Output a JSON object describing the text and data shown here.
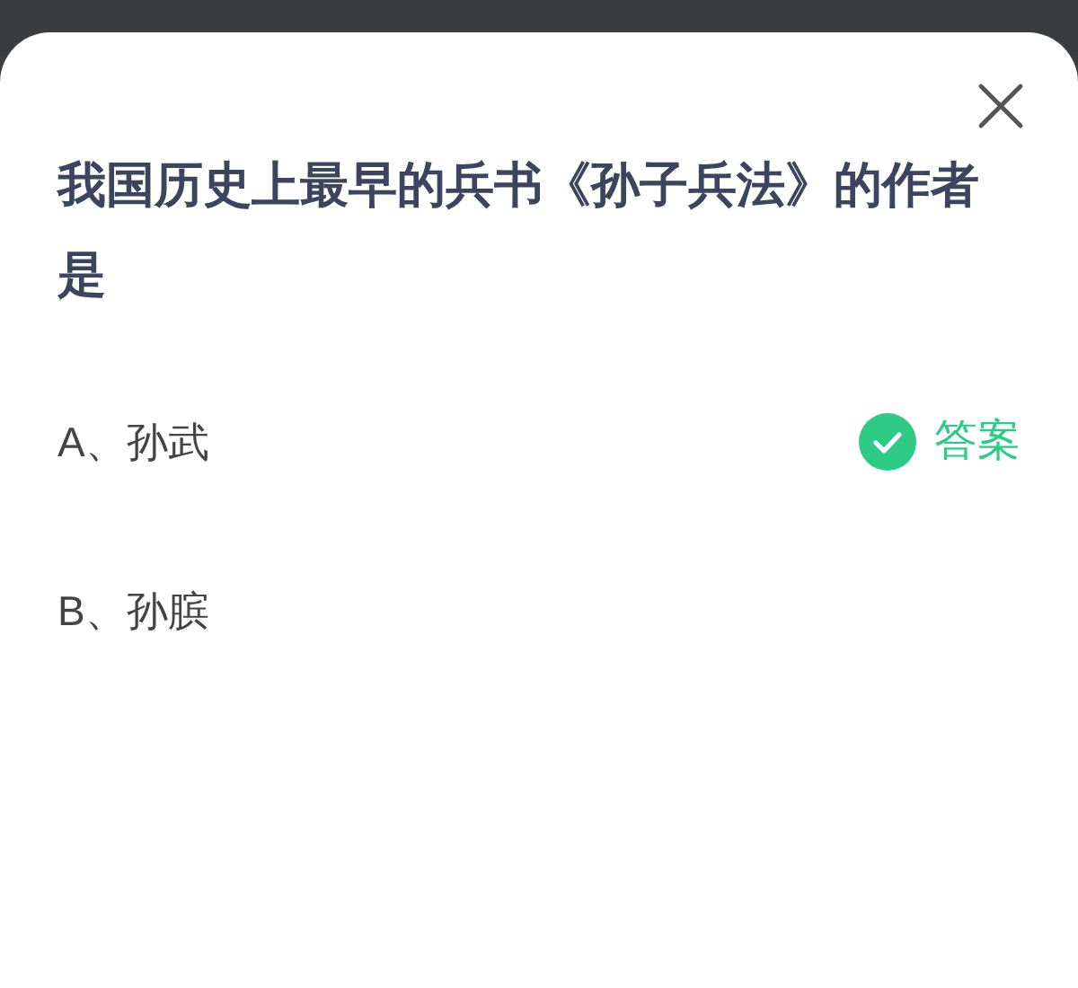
{
  "question": "我国历史上最早的兵书《孙子兵法》的作者是",
  "options": [
    {
      "label": "A、孙武",
      "answer_badge": "答案"
    },
    {
      "label": "B、孙膑"
    }
  ]
}
